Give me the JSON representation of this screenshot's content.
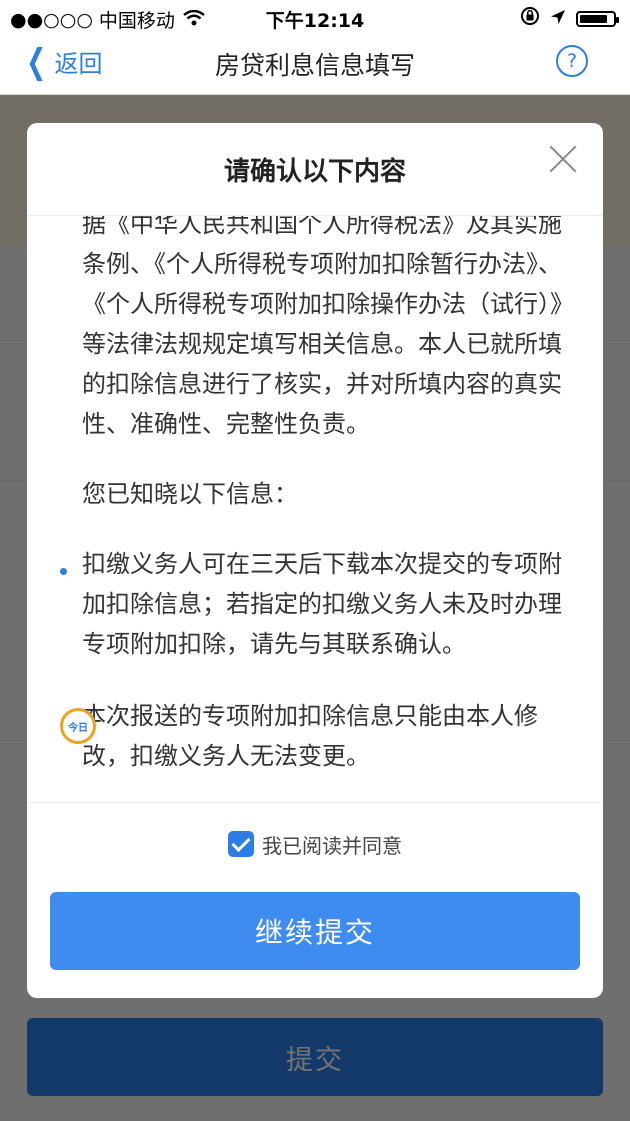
{
  "status_bar": {
    "signal": "●●○○○",
    "carrier": "中国移动",
    "wifi_icon": "wifi-icon",
    "time": "下午12:14",
    "battery_level": 0.85
  },
  "nav": {
    "back_label": "返回",
    "title": "房贷利息信息填写",
    "help_label": "?"
  },
  "dialog": {
    "title": "请确认以下内容",
    "paragraphs": [
      "据《中华人民共和国个人所得税法》及其实施条例、《个人所得税专项附加扣除暂行办法》、《个人所得税专项附加扣除操作办法（试行）》等法律法规规定填写相关信息。本人已就所填的扣除信息进行了核实，并对所填内容的真实性、准确性、完整性负责。",
      "您已知晓以下信息："
    ],
    "bullets": [
      "扣缴义务人可在三天后下载本次提交的专项附加扣除信息；若指定的扣缴义务人未及时办理专项附加扣除，请先与其联系确认。",
      "本次报送的专项附加扣除信息只能由本人修改，扣缴义务人无法变更。"
    ],
    "watermark_text": "今日",
    "agree_label": "我已阅读并同意",
    "agree_checked": true,
    "continue_label": "继续提交"
  },
  "page": {
    "submit_label": "提交"
  },
  "colors": {
    "accent": "#2a7ee6",
    "button": "#3f8cf0",
    "overlay": "rgba(0,0,0,0.55)"
  }
}
